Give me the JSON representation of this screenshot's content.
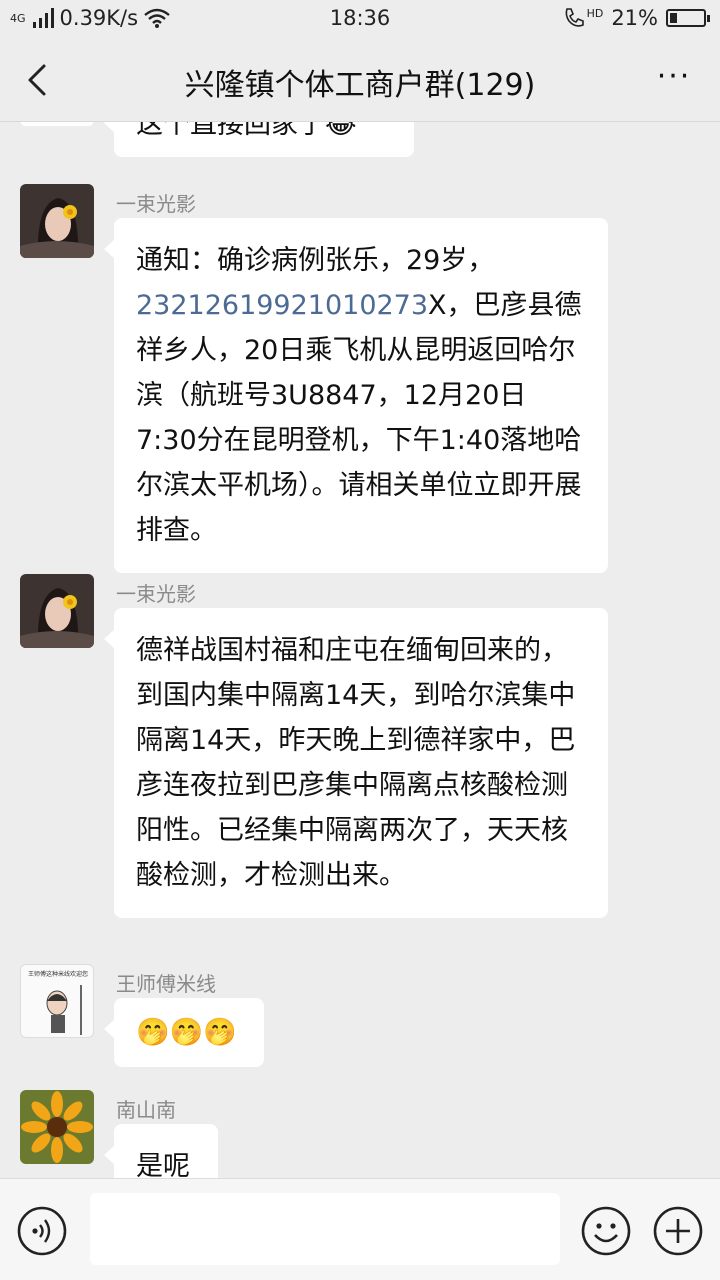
{
  "status_bar": {
    "network": "4G",
    "speed": "0.39K/s",
    "time": "18:36",
    "hd": "HD",
    "battery": "21%",
    "battery_level": 0.21
  },
  "header": {
    "title": "兴隆镇个体工商户群(129)",
    "more_label": "···"
  },
  "messages": [
    {
      "sender": "",
      "text": "这个直接回家了😂"
    },
    {
      "sender": "一束光影",
      "text_prefix": "通知：确诊病例张乐，29岁，",
      "id_number": "23212619921010273",
      "text_suffix": "X，巴彦县德祥乡人，20日乘飞机从昆明返回哈尔滨（航班号3U8847，12月20日7:30分在昆明登机，下午1:40落地哈尔滨太平机场）。请相关单位立即开展排查。"
    },
    {
      "sender": "一束光影",
      "text": "德祥战国村福和庄屯在缅甸回来的，到国内集中隔离14天，到哈尔滨集中隔离14天，昨天晚上到德祥家中，巴彦连夜拉到巴彦集中隔离点核酸检测阳性。已经集中隔离两次了，天天核酸检测，才检测出来。"
    },
    {
      "sender": "王师傅米线",
      "text": "🤭🤭🤭",
      "avatar_caption": "王师傅这种米线欢迎您"
    },
    {
      "sender": "南山南",
      "text": "是呢"
    }
  ],
  "colors": {
    "background": "#ededed",
    "bubble": "#ffffff",
    "sender": "#8a8a8a",
    "link": "#4b6a94"
  }
}
